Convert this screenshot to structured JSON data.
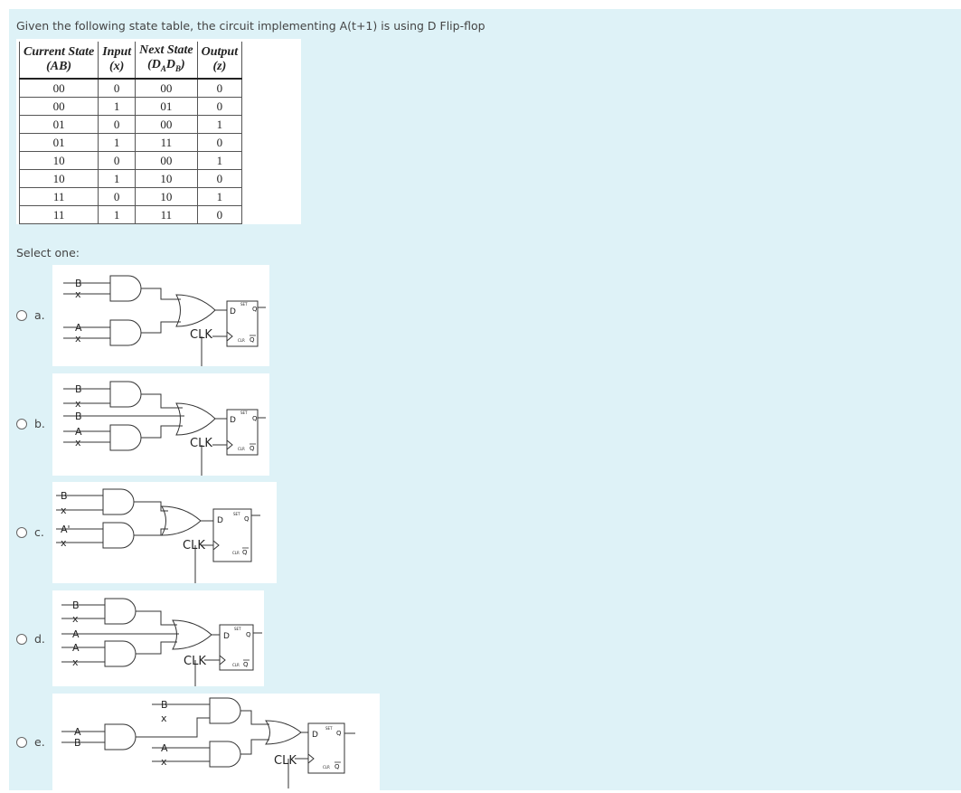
{
  "question": "Given the following state table, the circuit implementing A(t+1) is using D Flip-flop",
  "table": {
    "headers": [
      {
        "l1": "Current State",
        "l2": "(AB)"
      },
      {
        "l1": "Input",
        "l2": "(x)"
      },
      {
        "l1": "Next State",
        "l2": "(DADB)"
      },
      {
        "l1": "Output",
        "l2": "(z)"
      }
    ],
    "rows": [
      [
        "00",
        "0",
        "00",
        "0"
      ],
      [
        "00",
        "1",
        "01",
        "0"
      ],
      [
        "01",
        "0",
        "00",
        "1"
      ],
      [
        "01",
        "1",
        "11",
        "0"
      ],
      [
        "10",
        "0",
        "00",
        "1"
      ],
      [
        "10",
        "1",
        "10",
        "0"
      ],
      [
        "11",
        "0",
        "10",
        "1"
      ],
      [
        "11",
        "1",
        "11",
        "0"
      ]
    ]
  },
  "select_label": "Select one:",
  "options": [
    {
      "letter": "a."
    },
    {
      "letter": "b."
    },
    {
      "letter": "c."
    },
    {
      "letter": "d."
    },
    {
      "letter": "e."
    }
  ],
  "circuit_labels": {
    "clk": "CLK",
    "d": "D",
    "q": "Q",
    "qbar": "Q",
    "set": "SET",
    "clr": "CLR",
    "a": {
      "in1": "B",
      "in2": "x",
      "in3": "A",
      "in4": "x"
    },
    "b": {
      "in1": "B",
      "in2": "x",
      "in3": "B",
      "in4": "A",
      "in5": "x"
    },
    "c": {
      "in1": "B",
      "in2": "x",
      "in3": "A'",
      "in4": "x"
    },
    "d_opt": {
      "in1": "B",
      "in2": "x",
      "in3": "A",
      "in4": "A",
      "in5": "x"
    },
    "e": {
      "in1": "A",
      "in2": "B",
      "in3": "B",
      "in4": "x",
      "in5": "A",
      "in6": "x"
    }
  }
}
